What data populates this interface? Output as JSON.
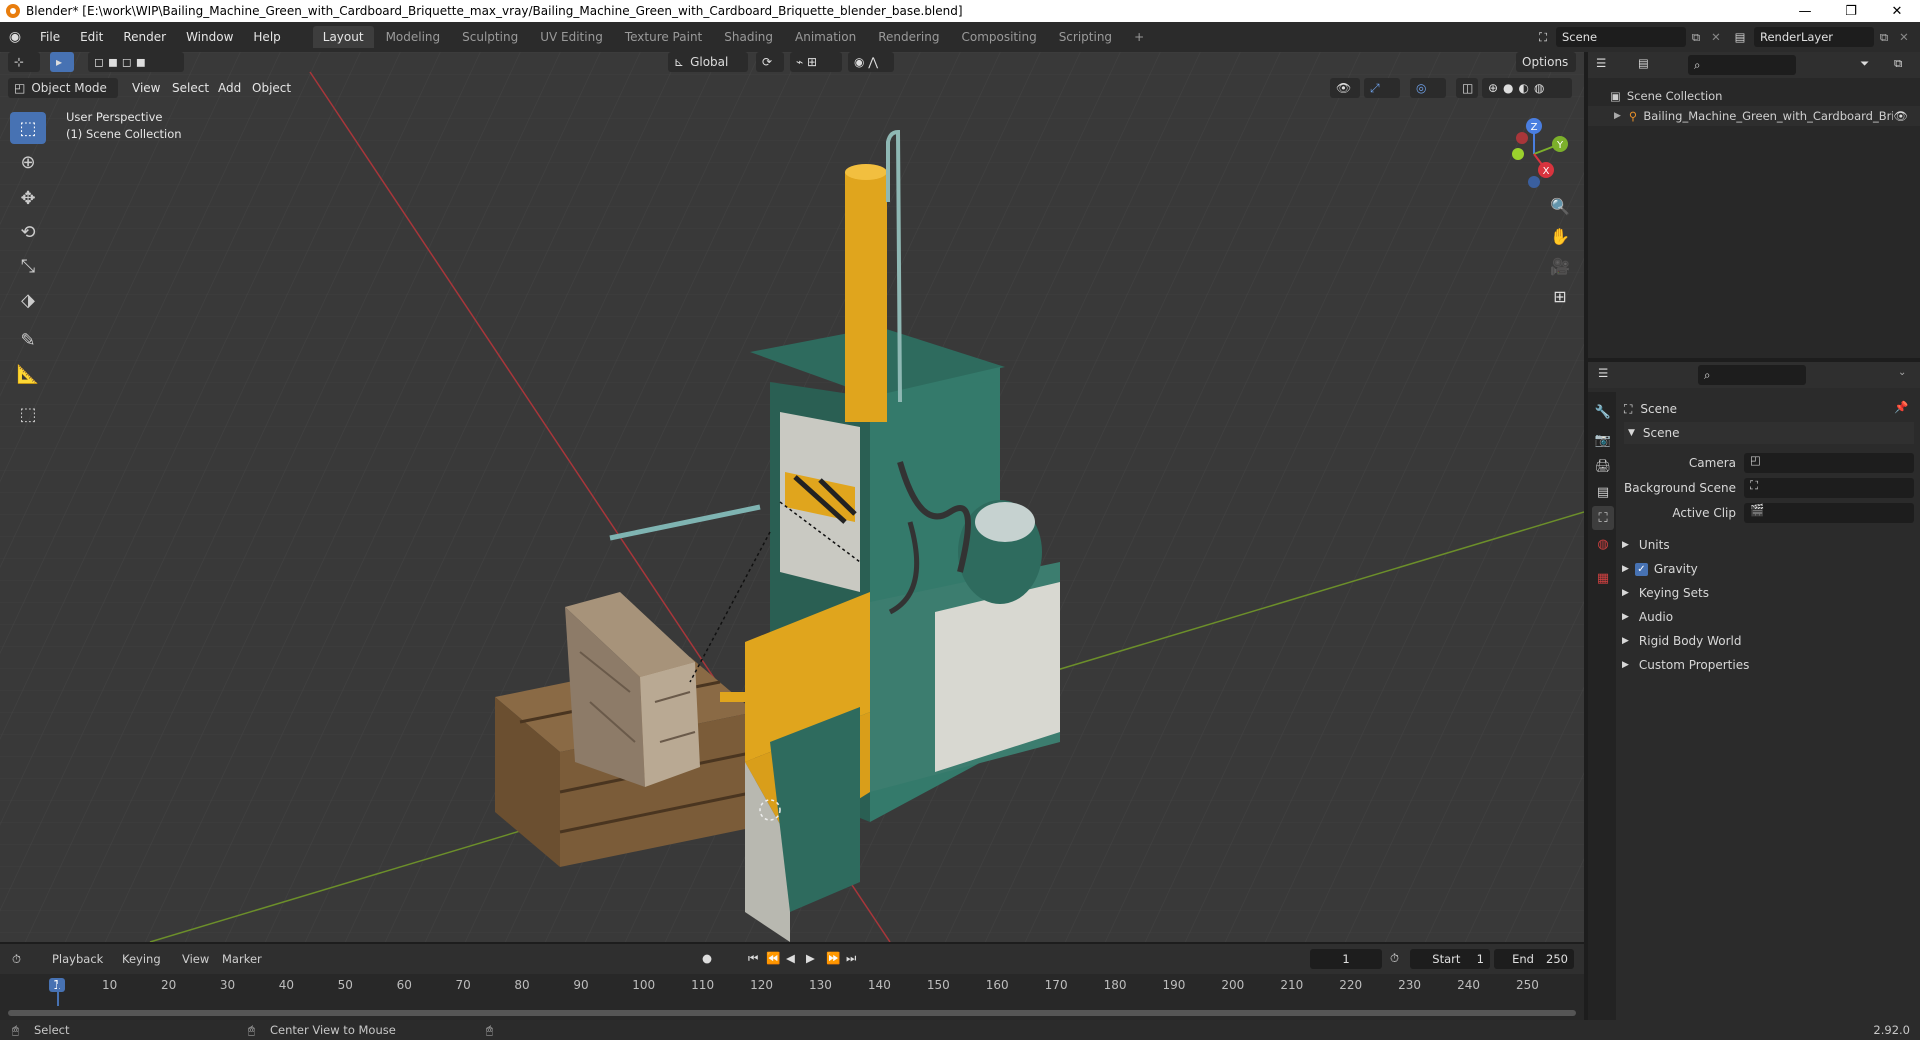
{
  "window": {
    "title": "Blender* [E:\\work\\WIP\\Bailing_Machine_Green_with_Cardboard_Briquette_max_vray/Bailing_Machine_Green_with_Cardboard_Briquette_blender_base.blend]"
  },
  "menu": [
    "File",
    "Edit",
    "Render",
    "Window",
    "Help"
  ],
  "workspace_tabs": [
    "Layout",
    "Modeling",
    "Sculpting",
    "UV Editing",
    "Texture Paint",
    "Shading",
    "Animation",
    "Rendering",
    "Compositing",
    "Scripting"
  ],
  "active_tab": "Layout",
  "scene_name": "Scene",
  "render_layer": "RenderLayer",
  "viewport": {
    "mode": "Object Mode",
    "menus": [
      "View",
      "Select",
      "Add",
      "Object"
    ],
    "transform_orientation": "Global",
    "options_label": "Options",
    "overlay_line1": "User Perspective",
    "overlay_line2": "(1) Scene Collection",
    "gizmo": {
      "z": "Z",
      "y": "Y",
      "x": "X"
    }
  },
  "outliner": {
    "root": "Scene Collection",
    "items": [
      "Bailing_Machine_Green_with_Cardboard_Bri"
    ]
  },
  "properties": {
    "header": "Scene",
    "section": "Scene",
    "fields": [
      {
        "label": "Camera"
      },
      {
        "label": "Background Scene"
      },
      {
        "label": "Active Clip"
      }
    ],
    "panels": [
      "Units",
      "Gravity",
      "Keying Sets",
      "Audio",
      "Rigid Body World",
      "Custom Properties"
    ],
    "gravity_checked": true
  },
  "timeline": {
    "menus": [
      "Playback",
      "Keying",
      "View",
      "Marker"
    ],
    "current_frame": "1",
    "start_label": "Start",
    "start": "1",
    "end_label": "End",
    "end": "250",
    "ticks": [
      "1",
      "10",
      "20",
      "30",
      "40",
      "50",
      "60",
      "70",
      "80",
      "90",
      "100",
      "110",
      "120",
      "130",
      "140",
      "150",
      "160",
      "170",
      "180",
      "190",
      "200",
      "210",
      "220",
      "230",
      "240",
      "250"
    ]
  },
  "status": {
    "left": "Select",
    "middle": "Center View to Mouse",
    "version": "2.92.0"
  },
  "colors": {
    "accent": "#4772b3",
    "machine_green": "#2e6b5e",
    "machine_yellow": "#e0a51d"
  }
}
